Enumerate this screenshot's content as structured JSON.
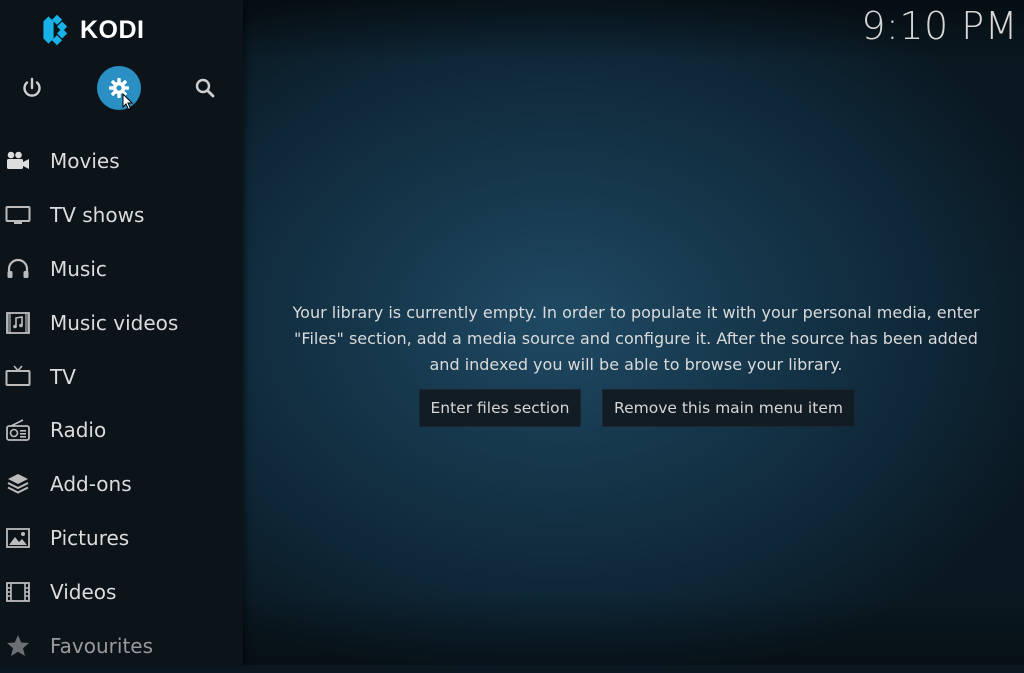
{
  "app": {
    "logo_text": "KODI"
  },
  "clock": "9:10 PM",
  "top_buttons": [
    {
      "name": "power",
      "icon": "power-icon"
    },
    {
      "name": "settings",
      "icon": "gear-icon",
      "active": true
    },
    {
      "name": "search",
      "icon": "search-icon"
    }
  ],
  "menu": [
    {
      "label": "Movies",
      "icon": "movie-camera-icon"
    },
    {
      "label": "TV shows",
      "icon": "monitor-icon"
    },
    {
      "label": "Music",
      "icon": "headphones-icon"
    },
    {
      "label": "Music videos",
      "icon": "film-music-icon"
    },
    {
      "label": "TV",
      "icon": "tv-icon"
    },
    {
      "label": "Radio",
      "icon": "radio-icon"
    },
    {
      "label": "Add-ons",
      "icon": "box-icon"
    },
    {
      "label": "Pictures",
      "icon": "picture-icon"
    },
    {
      "label": "Videos",
      "icon": "filmstrip-icon"
    },
    {
      "label": "Favourites",
      "icon": "star-icon"
    }
  ],
  "main": {
    "message_line1": "Your library is currently empty. In order to populate it with your personal media, enter",
    "message_line2": "\"Files\" section, add a media source and configure it. After the source has been added",
    "message_line3": "and indexed you will be able to browse your library.",
    "enter_files_label": "Enter files section",
    "remove_item_label": "Remove this main menu item"
  },
  "colors": {
    "accent": "#2a8fc2",
    "sidebar_bg": "#0c1319",
    "background": "#16384d"
  }
}
